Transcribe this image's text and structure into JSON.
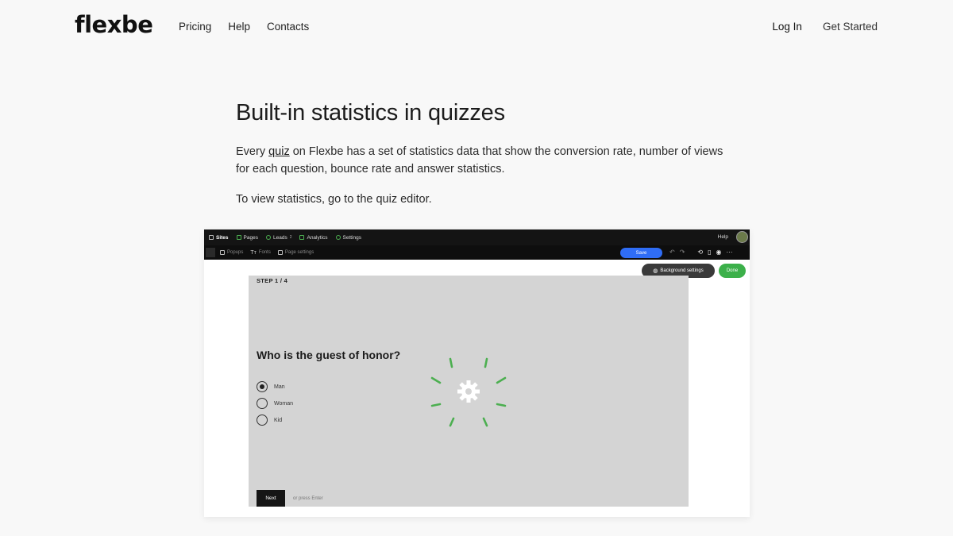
{
  "site": {
    "logo": "flexbe",
    "nav": [
      "Pricing",
      "Help",
      "Contacts"
    ],
    "login": "Log In",
    "get_started": "Get Started"
  },
  "article": {
    "title": "Built-in statistics in quizzes",
    "p1_before": "Every ",
    "p1_link": "quiz",
    "p1_after": " on Flexbe has a set of statistics data that show the conversion rate, number of views for each question, bounce rate and answer statistics.",
    "p2": "To view statistics, go to the quiz editor."
  },
  "editor": {
    "topbar": {
      "items": [
        "Sites",
        "Pages",
        "Leads",
        "Analytics",
        "Settings"
      ],
      "leads_badge": "2",
      "help": "Help"
    },
    "subbar": {
      "items": [
        "Popups",
        "Fonts",
        "Page settings"
      ],
      "save": "Save"
    },
    "background_settings": "Background settings",
    "done": "Done",
    "quiz": {
      "step": "STEP 1 / 4",
      "question": "Who is the guest of honor?",
      "options": [
        "Man",
        "Woman",
        "Kid"
      ],
      "selected": "Man",
      "next": "Next",
      "hint": "or press Enter"
    },
    "colors": {
      "accent_blue": "#2f6df6",
      "done_green": "#3cb04a",
      "spinner_green": "#4caf50"
    }
  }
}
